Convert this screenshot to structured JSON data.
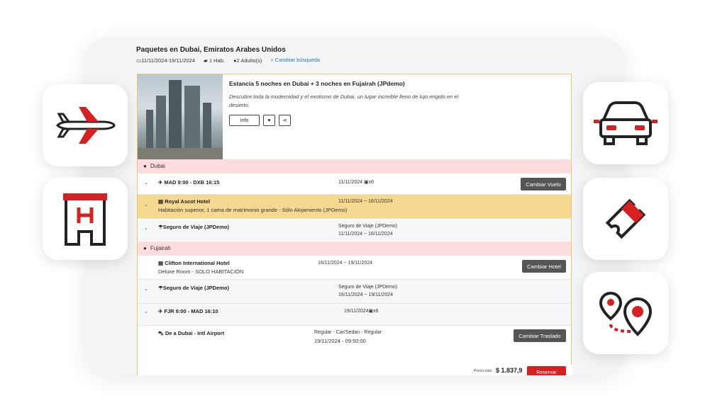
{
  "header": {
    "title": "Paquetes en Dubai, Emiratos Arabes Unidos",
    "dates": "11/11/2024-19/11/2024",
    "rooms": "1 Hab.",
    "adults": "2 Adulto(s)",
    "change_search": "Cambiar búsqueda"
  },
  "hero": {
    "title": "Estancia 5 noches en Dubai + 3 noches en Fujairah (JPdemo)",
    "description": "Descubre toda la modernidad y el exotismo de Dubai, un lugar increíble lleno de lujo erigido en el desierto.",
    "info_label": "Info"
  },
  "sections": {
    "dubai": "Dubai",
    "fujairah": "Fujairah"
  },
  "rows": {
    "flight1": {
      "label": "MAD 9:00 - DXB 16:15",
      "date": "11/11/2024",
      "bags": "x6",
      "button": "Cambiar Vuelo"
    },
    "hotel1": {
      "label": "Royal Ascot Hotel",
      "detail": "Habitación superior, 1 cama de matrimonio grande - Sólo Alojamiento (JPDemo)",
      "dates": "11/11/2024 ~ 16/11/2024"
    },
    "insurance1": {
      "label": "Seguro de Viaje (JPDemo)",
      "line1": "Seguro de Viaje (JPDemo)",
      "line2": "11/11/2024 ~ 16/11/2024"
    },
    "hotel2": {
      "label": "Clifton International Hotel",
      "detail": "Deluxe Room - SOLO HABITACIÓN",
      "dates": "16/11/2024 ~ 19/11/2024",
      "button": "Cambiar Hotel"
    },
    "insurance2": {
      "label": "Seguro de Viaje (JPDemo)",
      "line1": "Seguro de Viaje (JPDemo)",
      "line2": "16/11/2024 ~ 19/11/2024"
    },
    "flight2": {
      "label": "FJR 9:00 - MAD 16:10",
      "date": "19/11/2024",
      "bags": "x6"
    },
    "transfer": {
      "label": "De a Dubai - Intl Airport",
      "line1": "Regular - Car/Sedan - Regular",
      "line2": "19/11/2024 - 09:50:00",
      "button": "Cambiar Traslado"
    }
  },
  "footer": {
    "price_label": "Precio total",
    "price": "$ 1.837,9",
    "reserve": "Reservar"
  },
  "icons": {
    "accent": "#d62021",
    "tiles": [
      "airplane-icon",
      "hotel-icon",
      "car-icon",
      "ticket-icon",
      "route-pins-icon"
    ]
  }
}
